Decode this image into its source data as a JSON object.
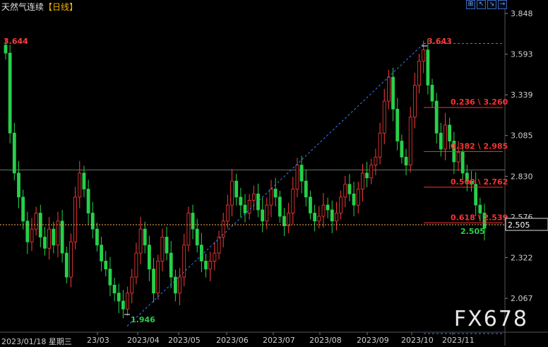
{
  "header": {
    "instrument": "天然气连续",
    "period": "【日线】",
    "toolbar": [
      "⊞",
      "↖",
      "↘",
      "→"
    ]
  },
  "watermark": "FX678",
  "first_date_label": "2023/01/18 星期三",
  "colors": {
    "up": "#ff3b3b",
    "down": "#27d04a",
    "background": "#000000",
    "grid": "#3a3a3a",
    "fib": "#ff3030",
    "trend": "#3d7cff",
    "price_line": "#ffb347"
  },
  "chart_data": {
    "type": "candlestick",
    "ylim": [
      1.86,
      3.848
    ],
    "y_ticks": [
      "3.848",
      "3.593",
      "3.339",
      "3.085",
      "2.830",
      "2.576",
      "2.322",
      "2.067"
    ],
    "x_labels": [
      "23/03",
      "2023/04",
      "2023/05",
      "2023/06",
      "2023/07",
      "2023/08",
      "2023/09",
      "2023/10",
      "2023/11"
    ],
    "last_price": "2.505",
    "annotations": {
      "start_high": "3.644",
      "period_low": "1.946",
      "period_high": "3.643",
      "current_low": "2.505"
    },
    "fibonacci": [
      {
        "label": "0.236 \\ 3.260",
        "value": 3.26
      },
      {
        "label": "0.382 \\ 2.985",
        "value": 2.985
      },
      {
        "label": "0.500 \\ 2.762",
        "value": 2.762
      },
      {
        "label": "0.618 \\ 2.539",
        "value": 2.539
      }
    ],
    "reference_line": 2.87,
    "trend_line": {
      "from": 1.946,
      "to": 3.66
    },
    "closes": [
      3.6,
      3.1,
      2.85,
      2.7,
      2.55,
      2.42,
      2.5,
      2.6,
      2.45,
      2.38,
      2.5,
      2.4,
      2.55,
      2.35,
      2.2,
      2.42,
      2.7,
      2.85,
      2.75,
      2.6,
      2.5,
      2.4,
      2.3,
      2.25,
      2.15,
      2.1,
      2.05,
      2.0,
      2.1,
      2.2,
      2.35,
      2.5,
      2.4,
      2.25,
      2.1,
      2.3,
      2.45,
      2.35,
      2.2,
      2.1,
      2.2,
      2.4,
      2.6,
      2.5,
      2.4,
      2.3,
      2.25,
      2.3,
      2.35,
      2.45,
      2.55,
      2.65,
      2.8,
      2.7,
      2.65,
      2.6,
      2.68,
      2.72,
      2.62,
      2.55,
      2.65,
      2.75,
      2.7,
      2.58,
      2.52,
      2.6,
      2.75,
      2.9,
      2.8,
      2.7,
      2.6,
      2.55,
      2.58,
      2.65,
      2.62,
      2.55,
      2.6,
      2.7,
      2.78,
      2.72,
      2.65,
      2.75,
      2.85,
      2.82,
      2.9,
      2.95,
      3.1,
      3.3,
      3.45,
      3.25,
      3.05,
      2.95,
      2.9,
      3.2,
      3.4,
      3.55,
      3.62,
      3.4,
      3.3,
      3.1,
      3.0,
      3.15,
      3.05,
      2.92,
      2.98,
      2.85,
      2.8,
      2.78,
      2.65,
      2.6,
      2.505
    ]
  }
}
